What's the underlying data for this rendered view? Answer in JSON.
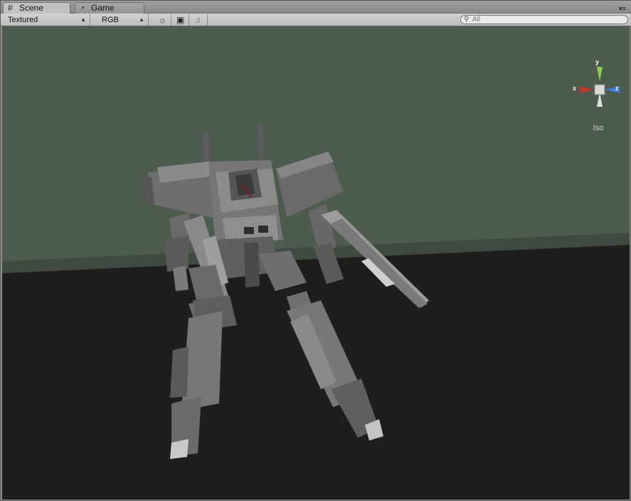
{
  "tabs": {
    "scene": {
      "label": "Scene",
      "icon": "grid-icon"
    },
    "game": {
      "label": "Game",
      "icon": "pacman-icon"
    }
  },
  "toolbar": {
    "render_mode": "Textured",
    "channel_mode": "RGB",
    "search_placeholder": "All"
  },
  "gizmo": {
    "x_label": "x",
    "y_label": "y",
    "z_label": "z",
    "projection": "Iso"
  },
  "colors": {
    "wall": "#4e5b4f",
    "floor": "#1f1e1d",
    "mech": "#7a7a7a",
    "gizmo_x": "#c0392b",
    "gizmo_y": "#8fd14f",
    "gizmo_z": "#3a7de0"
  }
}
